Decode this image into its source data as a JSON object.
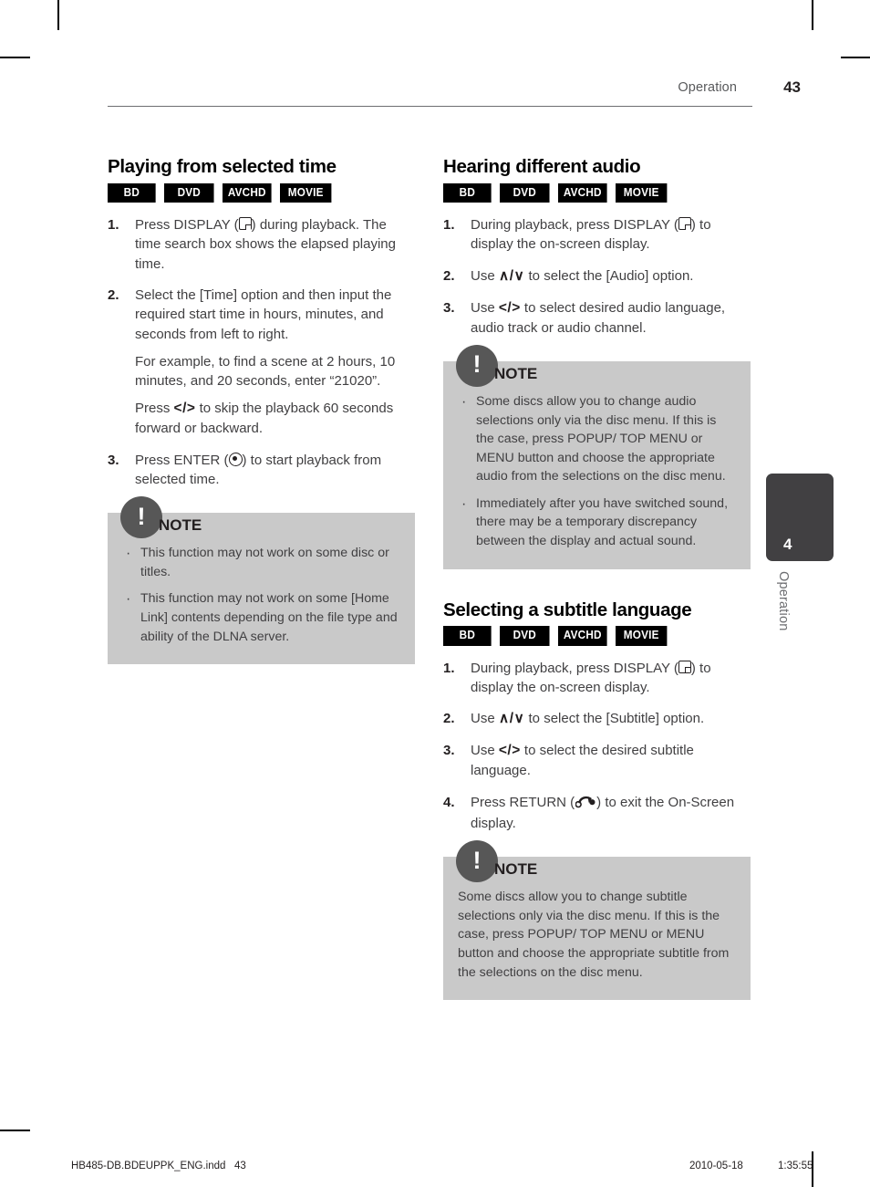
{
  "header": {
    "section": "Operation",
    "page_number": "43"
  },
  "left_column": {
    "title": "Playing from selected time",
    "badges": [
      "BD",
      "DVD",
      "AVCHD",
      "MOVIE"
    ],
    "steps": [
      {
        "num": "1.",
        "text_before_icon": "Press DISPLAY (",
        "icon": "display-icon",
        "text_after_icon": ") during playback. The time search box shows the elapsed playing time."
      },
      {
        "num": "2.",
        "text": " Select the [Time] option and then input the required start time in hours, minutes, and seconds from left to right.",
        "substeps": [
          "For example, to find a scene at 2 hours, 10 minutes, and 20 seconds, enter “21020”.",
          "Press </> to skip the playback 60 seconds forward or backward."
        ]
      },
      {
        "num": "3.",
        "text_before_icon": "Press ENTER (",
        "icon": "enter-icon",
        "text_after_icon": ") to start playback from selected time."
      }
    ],
    "note": {
      "title": "NOTE",
      "items": [
        "This function may not work on some disc or titles.",
        "This function may not work on some [Home Link] contents depending on the file type and ability of the DLNA server."
      ]
    }
  },
  "right_column": {
    "section_audio": {
      "title": "Hearing different audio",
      "badges": [
        "BD",
        "DVD",
        "AVCHD",
        "MOVIE"
      ],
      "steps": [
        {
          "num": "1.",
          "text_before_icon": "During playback, press DISPLAY (",
          "icon": "display-icon",
          "text_after_icon": ") to display the on-screen display."
        },
        {
          "num": "2.",
          "text_before_glyph": "Use ",
          "glyph": "∧/∨",
          "text_after_glyph": " to select the [Audio] option."
        },
        {
          "num": "3.",
          "text_before_glyph": "Use ",
          "glyph": "</>",
          "text_after_glyph": " to select desired audio language, audio track or audio channel."
        }
      ],
      "note": {
        "title": "NOTE",
        "items": [
          "Some discs allow you to change audio selections only via the disc menu. If this is the case, press POPUP/ TOP MENU or MENU button and choose the appropriate audio from the selections on the disc menu.",
          "Immediately after you have switched sound, there may be a temporary discrepancy between the display and actual sound."
        ]
      }
    },
    "section_subtitle": {
      "title": "Selecting a subtitle language",
      "badges": [
        "BD",
        "DVD",
        "AVCHD",
        "MOVIE"
      ],
      "steps": [
        {
          "num": "1.",
          "text_before_icon": "During playback, press DISPLAY (",
          "icon": "display-icon",
          "text_after_icon": ") to display the on-screen display."
        },
        {
          "num": "2.",
          "text_before_glyph": "Use ",
          "glyph": "∧/∨",
          "text_after_glyph": " to select the [Subtitle] option."
        },
        {
          "num": "3.",
          "text_before_glyph": "Use ",
          "glyph": "</>",
          "text_after_glyph": " to select the desired subtitle language."
        },
        {
          "num": "4.",
          "text_before_icon": "Press RETURN (",
          "icon": "return-icon",
          "text_after_icon": ") to exit the On-Screen display."
        }
      ],
      "note": {
        "title": "NOTE",
        "text": "Some discs allow you to change subtitle selections only via the disc menu. If this is the case, press POPUP/ TOP MENU or MENU button and choose the appropriate subtitle from the selections on the disc menu."
      }
    }
  },
  "side_tab": {
    "number": "4",
    "label": "Operation"
  },
  "footer": {
    "file_name": "HB485-DB.BDEUPPK_ENG.indd   43",
    "date": "2010-05-18",
    "time": "1:35:55"
  },
  "colors": {
    "note_background": "#c9c9c9",
    "note_circle": "#575757",
    "badge_background": "#000000",
    "side_tab": "#414042",
    "body_text": "#414042"
  }
}
